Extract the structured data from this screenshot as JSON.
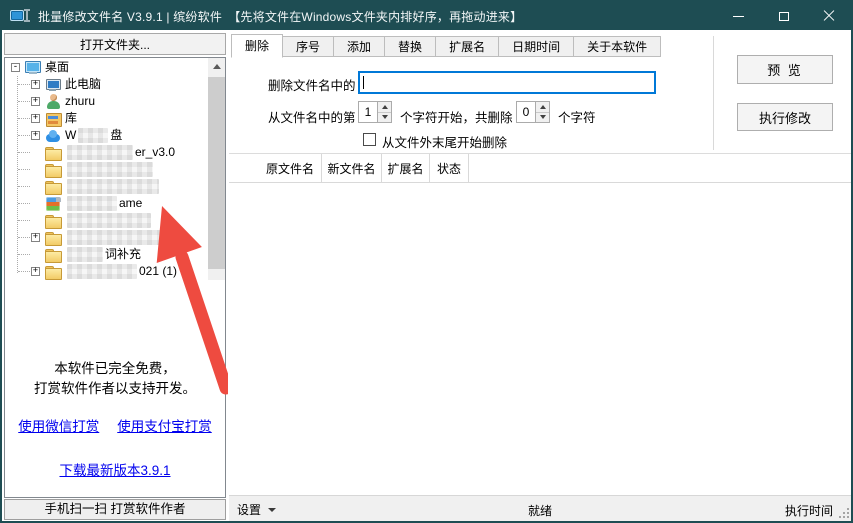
{
  "window": {
    "title": "批量修改文件名  V3.9.1 | 缤纷软件　【先将文件在Windows文件夹内排好序，再拖动进来】"
  },
  "left_panel": {
    "open_folder_button": "打开文件夹...",
    "tree": {
      "items": [
        {
          "icon": "desktop",
          "expander": "-",
          "label": "桌面",
          "indent": 0
        },
        {
          "icon": "computer",
          "expander": "+",
          "label": "此电脑",
          "indent": 1
        },
        {
          "icon": "user",
          "expander": "+",
          "label": "zhuru",
          "indent": 1
        },
        {
          "icon": "library",
          "expander": "+",
          "label": "库",
          "indent": 1
        },
        {
          "icon": "cloud",
          "expander": "+",
          "prefix": "W",
          "redact_w": 30,
          "label": "盘",
          "indent": 1
        },
        {
          "icon": "folder",
          "redact_w": 66,
          "label": "er_v3.0",
          "indent": 1
        },
        {
          "icon": "folder",
          "redact_w": 86,
          "indent": 1
        },
        {
          "icon": "folder",
          "redact_w": 92,
          "indent": 1
        },
        {
          "icon": "app",
          "redact_w": 50,
          "label": "ame",
          "indent": 1
        },
        {
          "icon": "folder",
          "redact_w": 84,
          "indent": 1
        },
        {
          "icon": "folder",
          "expander": "+",
          "redact_w": 94,
          "indent": 1
        },
        {
          "icon": "folder",
          "redact_w": 36,
          "label": "词补充",
          "indent": 1
        },
        {
          "icon": "folder",
          "expander": "+",
          "redact_w": 70,
          "label": "021 (1)",
          "indent": 1
        }
      ]
    },
    "donation_line1": "本软件已完全免费，",
    "donation_line2": "打赏软件作者以支持开发。",
    "wechat_link": "使用微信打赏",
    "alipay_link": "使用支付宝打赏",
    "download_link": "下载最新版本3.9.1",
    "bottom_bar": "手机扫一扫 打赏软件作者"
  },
  "tabs": {
    "items": [
      "删除",
      "序号",
      "添加",
      "替换",
      "扩展名",
      "日期时间",
      "关于本软件"
    ],
    "active_index": 0,
    "active": "删除"
  },
  "delete_tab": {
    "field1_label": "删除文件名中的",
    "input_value": "",
    "row2_prefix": "从文件名中的第",
    "spinner1_value": "1",
    "row2_mid": "个字符开始，共删除",
    "spinner2_value": "0",
    "row2_suffix": "个字符",
    "checkbox_label": "从文件外末尾开始删除",
    "checkbox_checked": false
  },
  "actions": {
    "preview_label": "预  览",
    "execute_label": "执行修改"
  },
  "table": {
    "headers": [
      "原文件名",
      "新文件名",
      "扩展名",
      "状态"
    ],
    "rows": []
  },
  "status_bar": {
    "settings_label": "设置",
    "status_text": "就绪",
    "exec_time_label": "执行时间"
  },
  "colors": {
    "titlebar": "#1E4D53",
    "input_focus_border": "#0078D7",
    "link_blue": "#0000EE",
    "arrow_red": "#EE4B40",
    "panel_gray": "#F0F0F0"
  },
  "icons": [
    "app-icon",
    "minimize-icon",
    "maximize-icon",
    "close-icon",
    "desktop-icon",
    "computer-icon",
    "user-icon",
    "library-icon",
    "cloud-icon",
    "folder-icon",
    "app-file-icon",
    "scroll-up-icon",
    "dropdown-caret-icon",
    "resize-grip-icon",
    "red-arrow"
  ]
}
